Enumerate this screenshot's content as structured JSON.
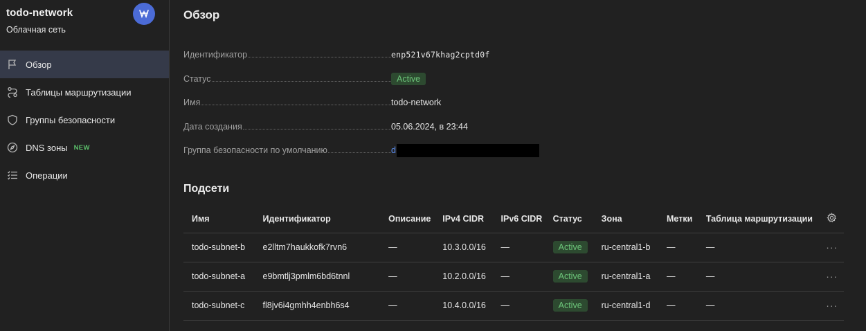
{
  "sidebar": {
    "title": "todo-network",
    "subtitle": "Облачная сеть",
    "badge_icon": "network-icon",
    "items": [
      {
        "label": "Обзор",
        "icon": "flag-icon",
        "active": true
      },
      {
        "label": "Таблицы маршрутизации",
        "icon": "route-icon"
      },
      {
        "label": "Группы безопасности",
        "icon": "shield-icon"
      },
      {
        "label": "DNS зоны",
        "icon": "compass-icon",
        "new_label": "NEW"
      },
      {
        "label": "Операции",
        "icon": "list-icon"
      }
    ]
  },
  "overview": {
    "title": "Обзор",
    "props": {
      "id_label": "Идентификатор",
      "id_value": "enp521v67khag2cptd0f",
      "status_label": "Статус",
      "status_value": "Active",
      "name_label": "Имя",
      "name_value": "todo-network",
      "created_label": "Дата создания",
      "created_value": "05.06.2024, в 23:44",
      "sg_label": "Группа безопасности по умолчанию",
      "sg_value": "d"
    }
  },
  "subnets": {
    "title": "Подсети",
    "columns": [
      "Имя",
      "Идентификатор",
      "Описание",
      "IPv4 CIDR",
      "IPv6 CIDR",
      "Статус",
      "Зона",
      "Метки",
      "Таблица маршрутизации"
    ],
    "rows": [
      {
        "name": "todo-subnet-b",
        "id": "e2lltm7haukkofk7rvn6",
        "desc": "—",
        "ipv4": "10.3.0.0/16",
        "ipv6": "—",
        "status": "Active",
        "zone": "ru-central1-b",
        "labels": "—",
        "route": "—"
      },
      {
        "name": "todo-subnet-a",
        "id": "e9bmtlj3pmlm6bd6tnnl",
        "desc": "—",
        "ipv4": "10.2.0.0/16",
        "ipv6": "—",
        "status": "Active",
        "zone": "ru-central1-a",
        "labels": "—",
        "route": "—"
      },
      {
        "name": "todo-subnet-c",
        "id": "fl8jv6i4gmhh4enbh6s4",
        "desc": "—",
        "ipv4": "10.4.0.0/16",
        "ipv6": "—",
        "status": "Active",
        "zone": "ru-central1-d",
        "labels": "—",
        "route": "—"
      }
    ],
    "more_label": "···"
  },
  "colors": {
    "accent": "#4b6bd6",
    "active_bg": "#2d4a30",
    "active_fg": "#6cc479",
    "link": "#5b8dee"
  }
}
